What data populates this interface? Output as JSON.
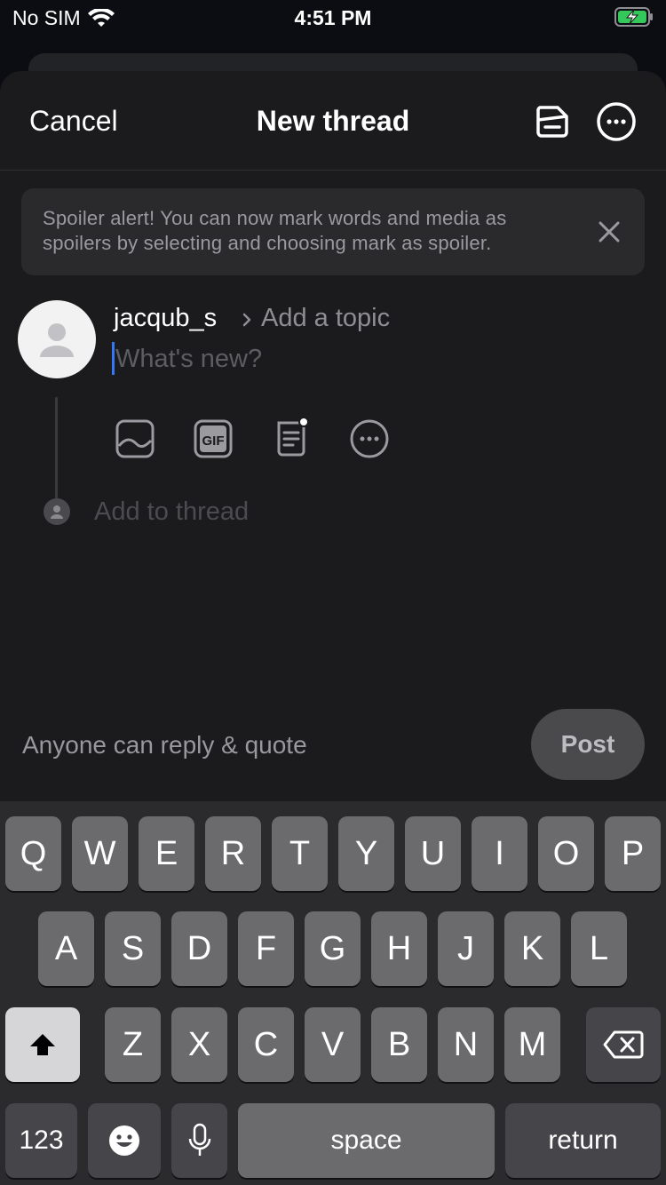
{
  "status_bar": {
    "carrier": "No SIM",
    "time": "4:51 PM"
  },
  "nav": {
    "cancel_label": "Cancel",
    "title": "New thread",
    "draft_icon": "drafts-icon",
    "more_icon": "more-icon"
  },
  "spoiler_banner": {
    "text": "Spoiler alert! You can now mark words and media as spoilers by selecting and choosing mark as spoiler."
  },
  "composer": {
    "username": "jacqub_s",
    "topic_placeholder": "Add a topic",
    "text_placeholder": "What's new?",
    "add_to_thread": "Add to thread",
    "attachments": [
      "image-icon",
      "gif-icon",
      "poll-icon",
      "more-icon"
    ]
  },
  "footer": {
    "reply_setting": "Anyone can reply & quote",
    "post_label": "Post"
  },
  "keyboard": {
    "row1": [
      "Q",
      "W",
      "E",
      "R",
      "T",
      "Y",
      "U",
      "I",
      "O",
      "P"
    ],
    "row2": [
      "A",
      "S",
      "D",
      "F",
      "G",
      "H",
      "J",
      "K",
      "L"
    ],
    "row3": [
      "Z",
      "X",
      "C",
      "V",
      "B",
      "N",
      "M"
    ],
    "numbers_label": "123",
    "space_label": "space",
    "return_label": "return"
  },
  "colors": {
    "accent_caret": "#3478f6",
    "battery_green": "#34c759"
  }
}
